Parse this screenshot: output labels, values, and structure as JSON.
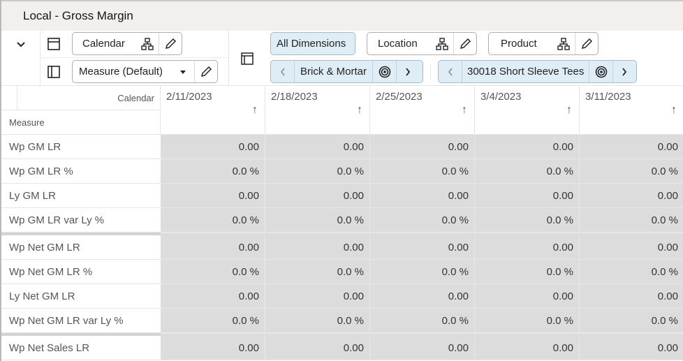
{
  "window": {
    "title": "Local - Gross Margin"
  },
  "toolbar": {
    "collapse_icon": "chevron-down-icon",
    "row_layout_icon": "row-layout-icon",
    "column_layout_icon": "column-layout-icon",
    "pivot_icon": "pivot-layout-icon",
    "row_dims": [
      {
        "label": "Calendar",
        "hierarchy_icon": "hierarchy-icon",
        "edit_icon": "pencil-icon"
      }
    ],
    "col_dims": [
      {
        "label": "Measure (Default)",
        "dropdown_icon": "caret-down-icon",
        "edit_icon": "pencil-icon"
      }
    ],
    "all_dimensions_label": "All Dimensions",
    "page_dims": [
      {
        "label": "Location",
        "hierarchy_icon": "hierarchy-icon",
        "edit_icon": "pencil-icon",
        "selected": "Brick & Mortar"
      },
      {
        "label": "Product",
        "hierarchy_icon": "hierarchy-icon",
        "edit_icon": "pencil-icon",
        "selected": "30018 Short Sleeve Tees"
      }
    ],
    "nav": {
      "prev_icon": "chevron-left-icon",
      "next_icon": "chevron-right-icon",
      "target_icon": "target-icon"
    }
  },
  "grid": {
    "corner": {
      "column_dim": "Calendar",
      "row_dim": "Measure"
    },
    "columns": [
      {
        "label": "2/11/2023",
        "sort_icon": "arrow-up-icon"
      },
      {
        "label": "2/18/2023",
        "sort_icon": "arrow-up-icon"
      },
      {
        "label": "2/25/2023",
        "sort_icon": "arrow-up-icon"
      },
      {
        "label": "3/4/2023",
        "sort_icon": "arrow-up-icon"
      },
      {
        "label": "3/11/2023",
        "sort_icon": "arrow-up-icon"
      }
    ],
    "rows": [
      {
        "label": "Wp GM LR",
        "values": [
          "0.00",
          "0.00",
          "0.00",
          "0.00",
          "0.00"
        ]
      },
      {
        "label": "Wp GM LR %",
        "values": [
          "0.0 %",
          "0.0 %",
          "0.0 %",
          "0.0 %",
          "0.0 %"
        ]
      },
      {
        "label": "Ly GM LR",
        "values": [
          "0.00",
          "0.00",
          "0.00",
          "0.00",
          "0.00"
        ]
      },
      {
        "label": "Wp GM LR var Ly %",
        "values": [
          "0.0 %",
          "0.0 %",
          "0.0 %",
          "0.0 %",
          "0.0 %"
        ]
      },
      {
        "label": "Wp Net GM LR",
        "values": [
          "0.00",
          "0.00",
          "0.00",
          "0.00",
          "0.00"
        ]
      },
      {
        "label": "Wp Net GM LR %",
        "values": [
          "0.0 %",
          "0.0 %",
          "0.0 %",
          "0.0 %",
          "0.0 %"
        ]
      },
      {
        "label": "Ly Net GM LR",
        "values": [
          "0.00",
          "0.00",
          "0.00",
          "0.00",
          "0.00"
        ]
      },
      {
        "label": "Wp Net GM LR var Ly %",
        "values": [
          "0.0 %",
          "0.0 %",
          "0.0 %",
          "0.0 %",
          "0.0 %"
        ]
      },
      {
        "label": "Wp Net Sales LR",
        "values": [
          "0.00",
          "0.00",
          "0.00",
          "0.00",
          "0.00"
        ]
      }
    ]
  }
}
